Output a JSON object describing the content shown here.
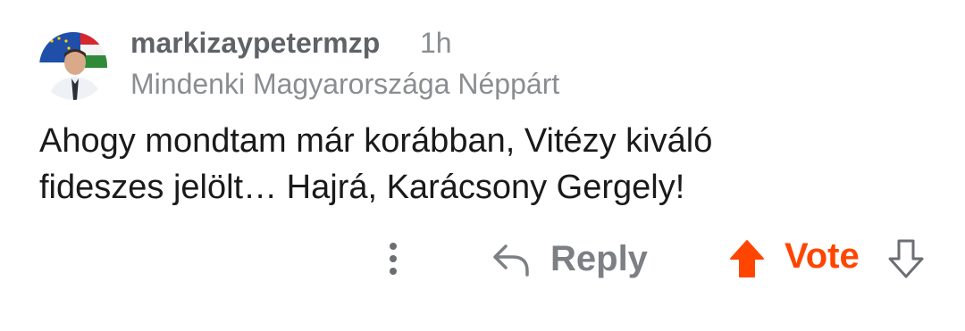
{
  "comment": {
    "username": "markizaypetermzp",
    "timestamp": "1h",
    "flair": "Mindenki Magyarországa Néppárt",
    "body_line1": "Ahogy mondtam már korábban, Vitézy kiváló",
    "body_line2": "fideszes jelölt… Hajrá, Karácsony Gergely!"
  },
  "actions": {
    "more_icon": "more-vertical-icon",
    "reply_icon": "reply-arrow-icon",
    "reply_label": "Reply",
    "upvote_icon": "upvote-arrow-icon",
    "vote_label": "Vote",
    "downvote_icon": "downvote-arrow-icon"
  },
  "colors": {
    "accent_orange": "#ff4500",
    "muted_gray": "#8a8d91",
    "text_dark": "#1a1a1b"
  }
}
